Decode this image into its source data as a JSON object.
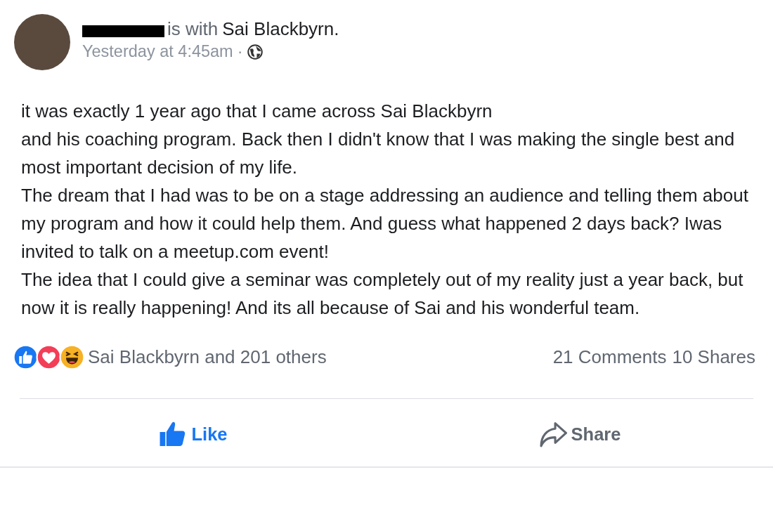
{
  "post": {
    "author_redacted": true,
    "with_text": "is with",
    "tagged": "Sai Blackbyrn.",
    "timestamp": "Yesterday at 4:45am",
    "separator": "·",
    "paragraphs": [
      "it was exactly 1 year ago that I came across Sai Blackbyrn",
      "and his coaching program. Back then I didn't know that I was making the single best and most important decision of my life.",
      "The dream that I had was to be on a stage addressing an audience and telling them about my program and how it could help them. And guess what happened 2 days back? Iwas invited to talk on a meetup.com event!",
      "The idea that I could give a seminar was completely out of my reality just a year back, but now it is really happening! And its all because of Sai and his wonderful team."
    ]
  },
  "reactions": {
    "summary": "Sai Blackbyrn and 201 others",
    "comments": "21 Comments",
    "shares": "10 Shares"
  },
  "actions": [
    {
      "kind": "like",
      "label": "Like",
      "selected": true
    },
    {
      "kind": "share",
      "label": "Share",
      "selected": false
    }
  ]
}
